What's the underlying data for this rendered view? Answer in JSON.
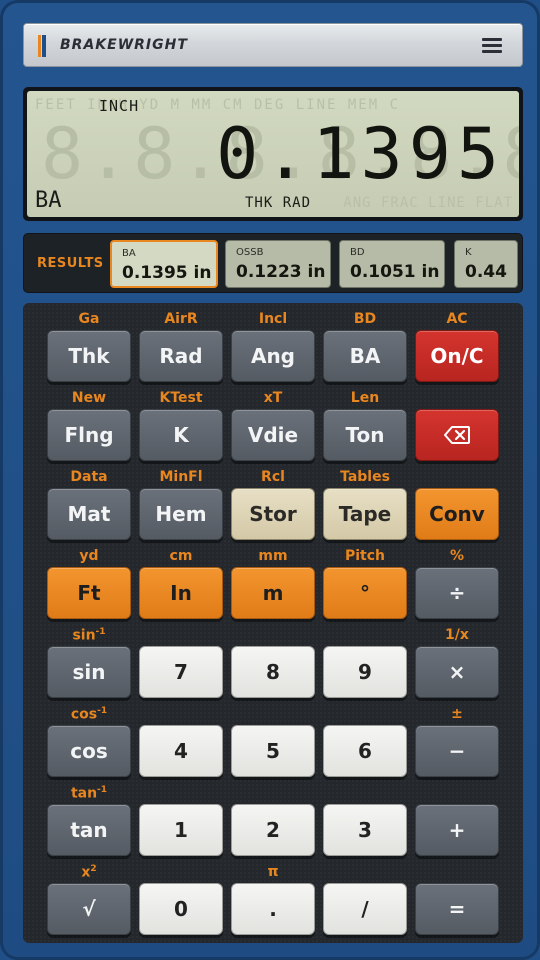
{
  "header": {
    "brand": "BRAKEWRIGHT"
  },
  "display": {
    "unit": "INCH",
    "value": "0.1395",
    "mode": "BA",
    "annunciators": "THK RAD",
    "ghost_top": "FEET   INCH   YD  M   MM   CM  DEG  LINE  MEM  C",
    "ghost_digits": "8.8.8.8.8.8.8.8.8",
    "ghost_bottom": "ANG FRAC LINE FLAT"
  },
  "results": {
    "label": "RESULTS",
    "items": [
      {
        "key": "BA",
        "value": "0.1395 in"
      },
      {
        "key": "OSSB",
        "value": "0.1223 in"
      },
      {
        "key": "BD",
        "value": "0.1051 in"
      },
      {
        "key": "K",
        "value": "0.44"
      }
    ]
  },
  "keys": {
    "r1": {
      "c1": "Ga",
      "k1": "Thk",
      "c2": "AirR",
      "k2": "Rad",
      "c3": "Incl",
      "k3": "Ang",
      "c4": "BD",
      "k4": "BA",
      "c5": "AC",
      "k5": "On/C"
    },
    "r2": {
      "c1": "New",
      "k1": "Flng",
      "c2": "KTest",
      "k2": "K",
      "c3": "xT",
      "k3": "Vdie",
      "c4": "Len",
      "k4": "Ton"
    },
    "r3": {
      "c1": "Data",
      "k1": "Mat",
      "c2": "MinFl",
      "k2": "Hem",
      "c3": "Rcl",
      "k3": "Stor",
      "c4": "Tables",
      "k4": "Tape",
      "k5": "Conv"
    },
    "r4": {
      "c1": "yd",
      "k1": "Ft",
      "c2": "cm",
      "k2": "In",
      "c3": "mm",
      "k3": "m",
      "c4": "Pitch",
      "k4": "°",
      "c5": "%",
      "k5": "÷"
    },
    "r5": {
      "c1": "sin",
      "c1sup": "-1",
      "k1": "sin",
      "k2": "7",
      "k3": "8",
      "k4": "9",
      "c5": "1/x",
      "k5": "×"
    },
    "r6": {
      "c1": "cos",
      "c1sup": "-1",
      "k1": "cos",
      "k2": "4",
      "k3": "5",
      "k4": "6",
      "c5": "±",
      "k5": "−"
    },
    "r7": {
      "c1": "tan",
      "c1sup": "-1",
      "k1": "tan",
      "k2": "1",
      "k3": "2",
      "k4": "3",
      "k5": "+"
    },
    "r8": {
      "c1": "x",
      "c1sup": "2",
      "k1": "√",
      "k2": "0",
      "c3": "π",
      "k3": ".",
      "k4": "/",
      "k5": "="
    }
  },
  "colors": {
    "accent": "#e8861f",
    "body": "#1f4f86",
    "clear": "#c92c27",
    "lcd": "#c9d0b7"
  }
}
